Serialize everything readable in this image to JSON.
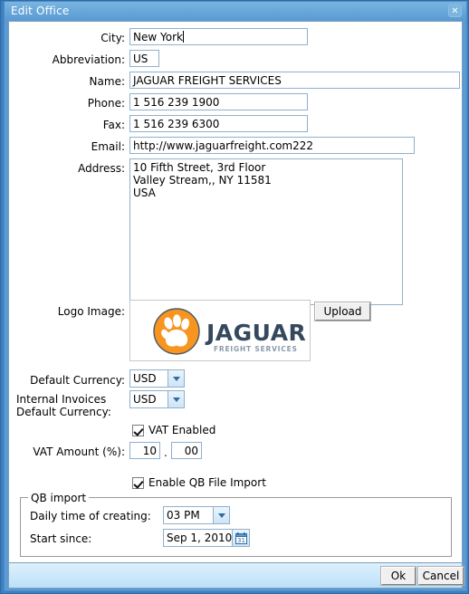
{
  "window": {
    "title": "Edit Office",
    "close_icon": "close-icon",
    "close_glyph": "✕"
  },
  "form": {
    "city": {
      "label": "City:",
      "value": "New York"
    },
    "abbreviation": {
      "label": "Abbreviation:",
      "value": "US"
    },
    "name": {
      "label": "Name:",
      "value": "JAGUAR FREIGHT SERVICES"
    },
    "phone": {
      "label": "Phone:",
      "value": "1 516 239 1900"
    },
    "fax": {
      "label": "Fax:",
      "value": "1 516 239 6300"
    },
    "email": {
      "label": "Email:",
      "value": "http://www.jaguarfreight.com222"
    },
    "address": {
      "label": "Address:",
      "value": "10 Fifth Street, 3rd Floor\nValley Stream,, NY 11581\nUSA"
    },
    "logo": {
      "label": "Logo Image:",
      "upload_label": "Upload",
      "brand_name": "JAGUAR",
      "brand_tagline": "FREIGHT SERVICES",
      "paw_icon": "paw-print-icon",
      "brand_color": "#f79520",
      "brand_text_color": "#34495e"
    },
    "default_currency": {
      "label": "Default Currency:",
      "value": "USD",
      "arrow_icon": "chevron-down-icon"
    },
    "internal_currency": {
      "label_line1": "Internal Invoices",
      "label_line2": "Default Currency:",
      "value": "USD",
      "arrow_icon": "chevron-down-icon"
    },
    "vat_enabled": {
      "label": "VAT Enabled",
      "checked": true
    },
    "vat_amount": {
      "label": "VAT Amount (%):",
      "whole": "10",
      "separator": ".",
      "fraction": "00"
    },
    "qb_enabled": {
      "label": "Enable QB File Import",
      "checked": true
    },
    "qb_import": {
      "legend": "QB import",
      "daily_time": {
        "label": "Daily time of creating:",
        "value": "03 PM",
        "arrow_icon": "chevron-down-icon"
      },
      "start_since": {
        "label": "Start since:",
        "value": "Sep 1, 2010",
        "calendar_icon": "calendar-icon",
        "calendar_glyph": "31"
      }
    }
  },
  "footer": {
    "ok_label": "Ok",
    "cancel_label": "Cancel"
  }
}
